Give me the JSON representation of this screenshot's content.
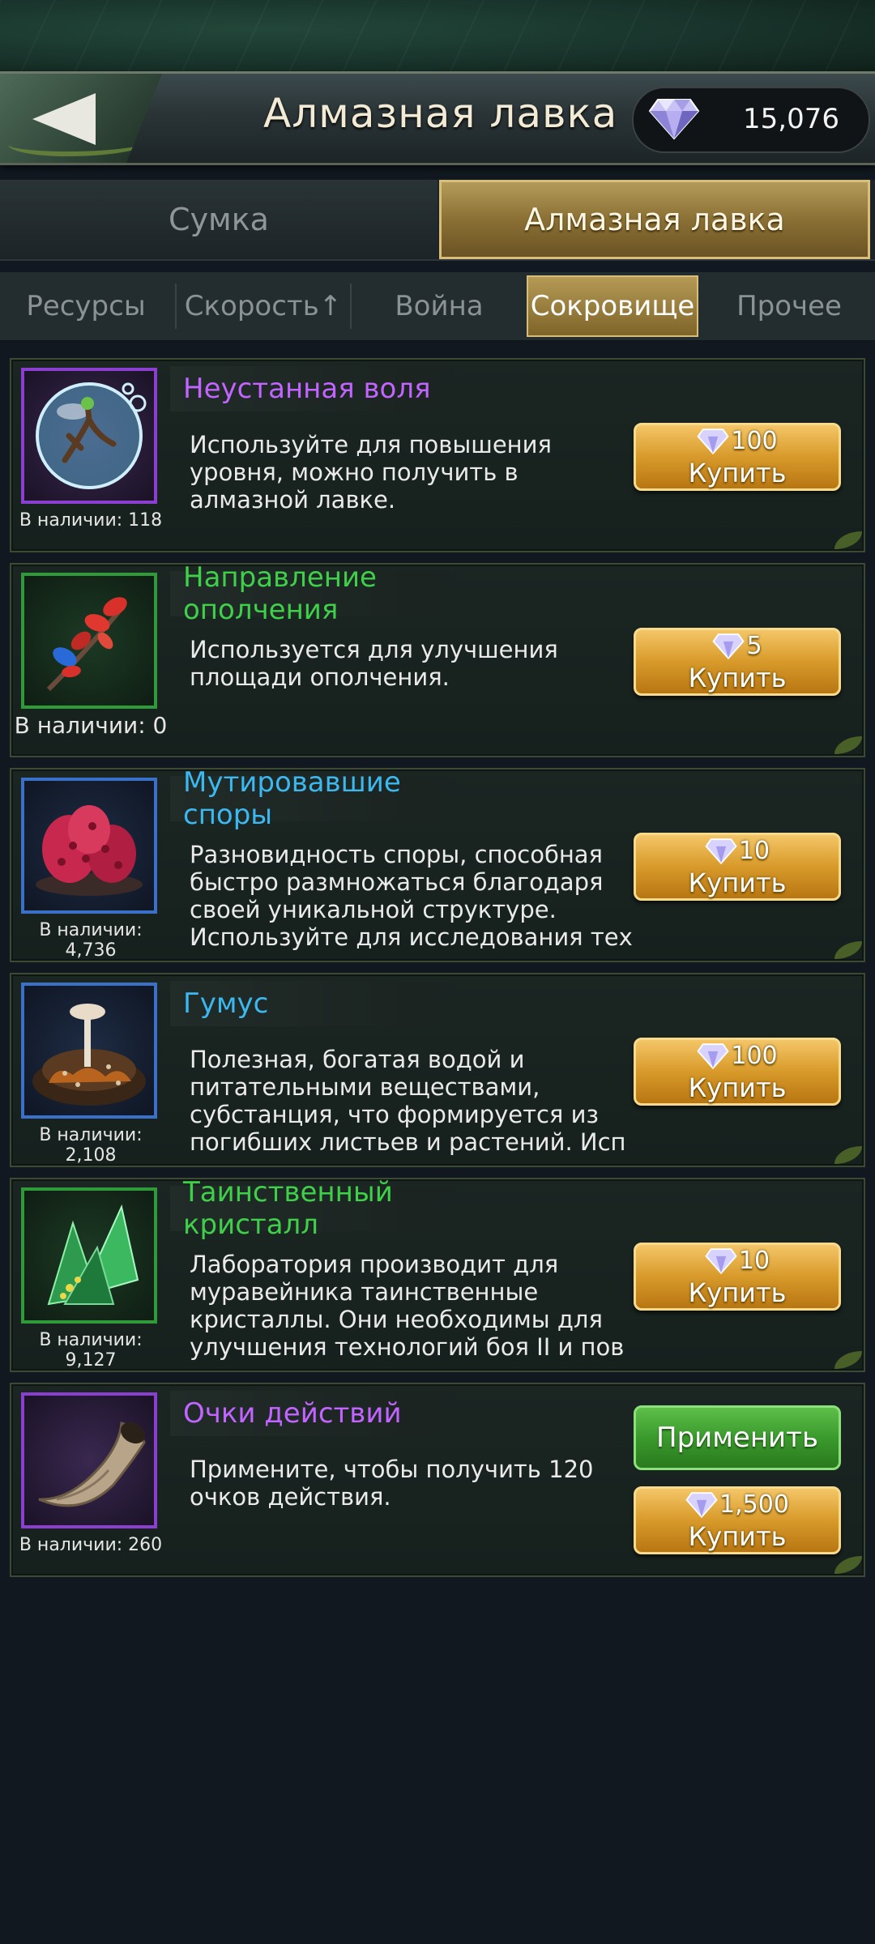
{
  "header": {
    "title": "Алмазная лавка",
    "currency_amount": "15,076",
    "back_icon": "back-arrow-icon",
    "currency_icon": "diamond-icon"
  },
  "main_tabs": [
    {
      "label": "Сумка",
      "active": false
    },
    {
      "label": "Алмазная лавка",
      "active": true
    }
  ],
  "sub_tabs": [
    {
      "label": "Ресурсы",
      "active": false
    },
    {
      "label": "Скорость↑",
      "active": false
    },
    {
      "label": "Война",
      "active": false
    },
    {
      "label": "Сокровище",
      "active": true
    },
    {
      "label": "Прочее",
      "active": false
    }
  ],
  "items": [
    {
      "name": "Неустанная воля",
      "description": "Используйте для повышения уровня, можно получить в алмазной лавке.",
      "stock": "В наличии: 118",
      "price": "100",
      "buy_label": "Купить",
      "rarity_color": "#8a3fd0",
      "icon": "bubble-branch-icon"
    },
    {
      "name": "Направление ополчения",
      "description": "Используется для улучшения площади ополчения.",
      "stock": "В наличии: 0",
      "price": "5",
      "buy_label": "Купить",
      "rarity_color": "#2f9a3a",
      "icon": "red-leaf-branch-icon"
    },
    {
      "name": "Мутировавшие споры",
      "description": "Разновидность споры, способная быстро размножаться благодаря своей уникальной структуре. Используйте для исследования тех",
      "stock": "В наличии: 4,736",
      "price": "10",
      "buy_label": "Купить",
      "rarity_color": "#3a70c8",
      "icon": "red-spores-icon"
    },
    {
      "name": "Гумус",
      "description": "Полезная, богатая водой и питательными веществами, субстанция, что формируется из погибших листьев и растений. Исп",
      "stock": "В наличии: 2,108",
      "price": "100",
      "buy_label": "Купить",
      "rarity_color": "#3a70c8",
      "icon": "soil-mushroom-icon"
    },
    {
      "name": "Таинственный кристалл",
      "description": "Лаборатория производит для муравейника таинственные кристаллы. Они необходимы для улучшения технологий боя II и пов",
      "stock": "В наличии: 9,127",
      "price": "10",
      "buy_label": "Купить",
      "rarity_color": "#2f9a3a",
      "icon": "green-crystal-icon"
    },
    {
      "name": "Очки действий",
      "description": "Примените, чтобы получить 120 очков действия.",
      "stock": "В наличии: 260",
      "price": "1,500",
      "buy_label": "Купить",
      "apply_label": "Применить",
      "rarity_color": "#8a3fd0",
      "icon": "horn-icon"
    }
  ]
}
